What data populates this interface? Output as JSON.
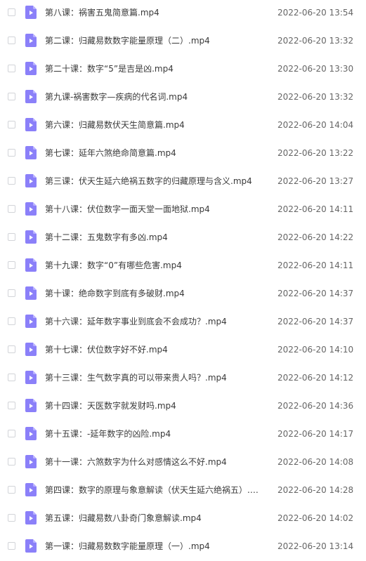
{
  "file_icon": "video-file-icon",
  "colors": {
    "icon_fill": "#8b80f9",
    "icon_fold": "#b9b2ff",
    "checkbox_border": "#d2d4d8"
  },
  "files": [
    {
      "name": "第八课：祸害五鬼简意篇.mp4",
      "date": "2022-06-20 13:54"
    },
    {
      "name": "第二课：归藏易数数字能量原理（二）.mp4",
      "date": "2022-06-20 13:32"
    },
    {
      "name": "第二十课：数字“5”是吉是凶.mp4",
      "date": "2022-06-20 13:30"
    },
    {
      "name": "第九课-祸害数字—疾病的代名词.mp4",
      "date": "2022-06-20 13:32"
    },
    {
      "name": "第六课：归藏易数伏天生简意篇.mp4",
      "date": "2022-06-20 14:04"
    },
    {
      "name": "第七课：延年六煞绝命简意篇.mp4",
      "date": "2022-06-20 13:22"
    },
    {
      "name": "第三课：伏天生延六绝祸五数字的归藏原理与含义.mp4",
      "date": "2022-06-20 13:27"
    },
    {
      "name": "第十八课：伏位数字一面天堂一面地狱.mp4",
      "date": "2022-06-20 14:11"
    },
    {
      "name": "第十二课：五鬼数字有多凶.mp4",
      "date": "2022-06-20 14:22"
    },
    {
      "name": "第十九课：数字“0”有哪些危害.mp4",
      "date": "2022-06-20 14:11"
    },
    {
      "name": "第十课：绝命数字到底有多破财.mp4",
      "date": "2022-06-20 14:37"
    },
    {
      "name": "第十六课：延年数字事业到底会不会成功？.mp4",
      "date": "2022-06-20 14:37"
    },
    {
      "name": "第十七课：伏位数字好不好.mp4",
      "date": "2022-06-20 14:10"
    },
    {
      "name": "第十三课：生气数字真的可以带来贵人吗？.mp4",
      "date": "2022-06-20 14:12"
    },
    {
      "name": "第十四课：天医数字就发财吗.mp4",
      "date": "2022-06-20 14:36"
    },
    {
      "name": "第十五课：-延年数字的凶险.mp4",
      "date": "2022-06-20 14:17"
    },
    {
      "name": "第十一课：六煞数字为什么对感情这么不好.mp4",
      "date": "2022-06-20 14:08"
    },
    {
      "name": "第四课：数字的原理与象意解读（伏天生延六绝祸五）.m...",
      "date": "2022-06-20 14:28"
    },
    {
      "name": "第五课：归藏易数八卦奇门象意解读.mp4",
      "date": "2022-06-20 14:02"
    },
    {
      "name": "第一课：归藏易数数字能量原理（一）.mp4",
      "date": "2022-06-20 13:14"
    }
  ]
}
